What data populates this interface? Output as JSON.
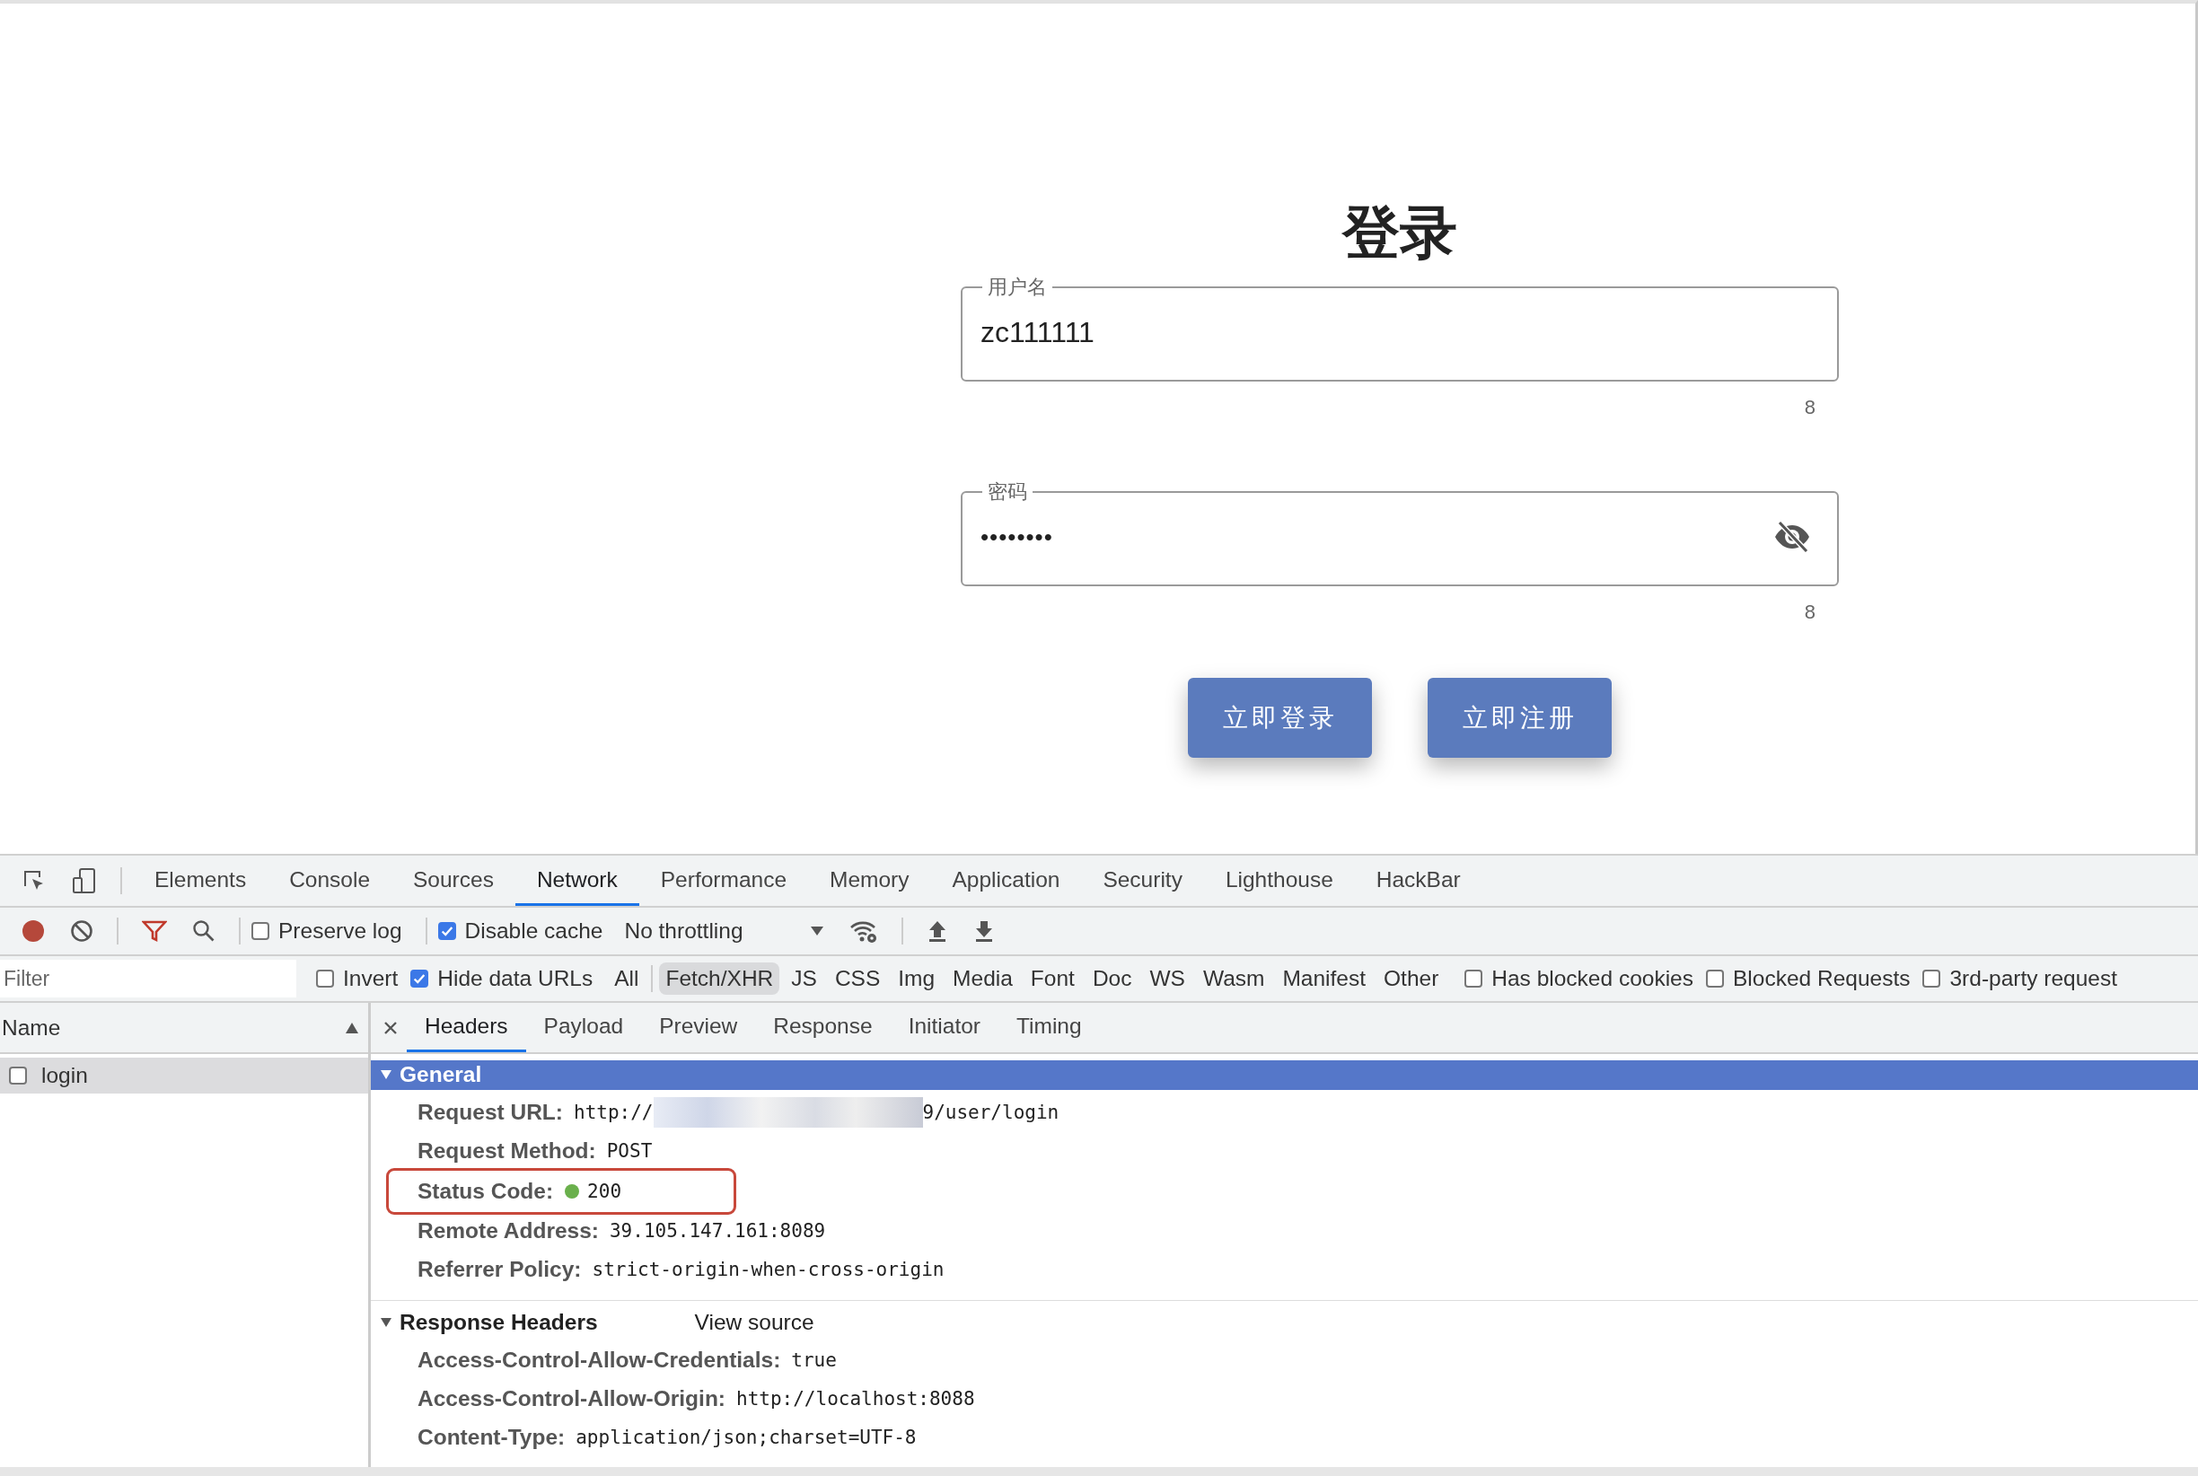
{
  "page": {
    "title": "登录",
    "fields": [
      {
        "kind": "text",
        "label": "用户名",
        "value": "zc111111",
        "counter": "8"
      },
      {
        "kind": "password",
        "label": "密码",
        "value": "••••••••",
        "counter": "8"
      }
    ],
    "buttons": [
      "立即登录",
      "立即注册"
    ]
  },
  "devtools": {
    "tabs": [
      {
        "label": "Elements",
        "selected": false
      },
      {
        "label": "Console",
        "selected": false
      },
      {
        "label": "Sources",
        "selected": false
      },
      {
        "label": "Network",
        "selected": true
      },
      {
        "label": "Performance",
        "selected": false
      },
      {
        "label": "Memory",
        "selected": false
      },
      {
        "label": "Application",
        "selected": false
      },
      {
        "label": "Security",
        "selected": false
      },
      {
        "label": "Lighthouse",
        "selected": false
      },
      {
        "label": "HackBar",
        "selected": false
      }
    ],
    "toolbar": {
      "recording": true,
      "filter_active": true,
      "preserve_log": {
        "label": "Preserve log",
        "checked": false
      },
      "disable_cache": {
        "label": "Disable cache",
        "checked": true
      },
      "throttling": "No throttling"
    },
    "filter": {
      "placeholder": "Filter",
      "invert": {
        "label": "Invert",
        "checked": false
      },
      "hide_data_urls": {
        "label": "Hide data URLs",
        "checked": true
      },
      "types": [
        {
          "label": "All",
          "selected": false
        },
        {
          "label": "Fetch/XHR",
          "selected": true
        },
        {
          "label": "JS",
          "selected": false
        },
        {
          "label": "CSS",
          "selected": false
        },
        {
          "label": "Img",
          "selected": false
        },
        {
          "label": "Media",
          "selected": false
        },
        {
          "label": "Font",
          "selected": false
        },
        {
          "label": "Doc",
          "selected": false
        },
        {
          "label": "WS",
          "selected": false
        },
        {
          "label": "Wasm",
          "selected": false
        },
        {
          "label": "Manifest",
          "selected": false
        },
        {
          "label": "Other",
          "selected": false
        }
      ],
      "options": [
        {
          "label": "Has blocked cookies",
          "checked": false
        },
        {
          "label": "Blocked Requests",
          "checked": false
        },
        {
          "label": "3rd-party request",
          "checked": false
        }
      ]
    },
    "requests": {
      "column": "Name",
      "rows": [
        {
          "name": "login",
          "checked": false,
          "selected": true
        }
      ]
    },
    "detail_tabs": [
      {
        "label": "Headers",
        "selected": true
      },
      {
        "label": "Payload",
        "selected": false
      },
      {
        "label": "Preview",
        "selected": false
      },
      {
        "label": "Response",
        "selected": false
      },
      {
        "label": "Initiator",
        "selected": false
      },
      {
        "label": "Timing",
        "selected": false
      }
    ],
    "sections": [
      {
        "title": "General",
        "expanded": true,
        "highlighted": true,
        "rows": [
          {
            "kind": "plain",
            "name": "Request URL:",
            "value": "http://",
            "value_tail": "9/user/login",
            "redacted": true,
            "annotated": false
          },
          {
            "kind": "plain",
            "name": "Request Method:",
            "value": "POST",
            "annotated": false
          },
          {
            "kind": "status",
            "name": "Status Code:",
            "value": "200",
            "annotated": true
          },
          {
            "kind": "plain",
            "name": "Remote Address:",
            "value": "39.105.147.161:8089",
            "annotated": false
          },
          {
            "kind": "plain",
            "name": "Referrer Policy:",
            "value": "strict-origin-when-cross-origin",
            "annotated": false
          }
        ]
      },
      {
        "title": "Response Headers",
        "expanded": true,
        "highlighted": false,
        "link": "View source",
        "rows": [
          {
            "kind": "plain",
            "name": "Access-Control-Allow-Credentials:",
            "value": "true",
            "annotated": false
          },
          {
            "kind": "plain",
            "name": "Access-Control-Allow-Origin:",
            "value": "http://localhost:8088",
            "annotated": false
          },
          {
            "kind": "plain",
            "name": "Content-Type:",
            "value": "application/json;charset=UTF-8",
            "annotated": false
          }
        ]
      }
    ]
  }
}
